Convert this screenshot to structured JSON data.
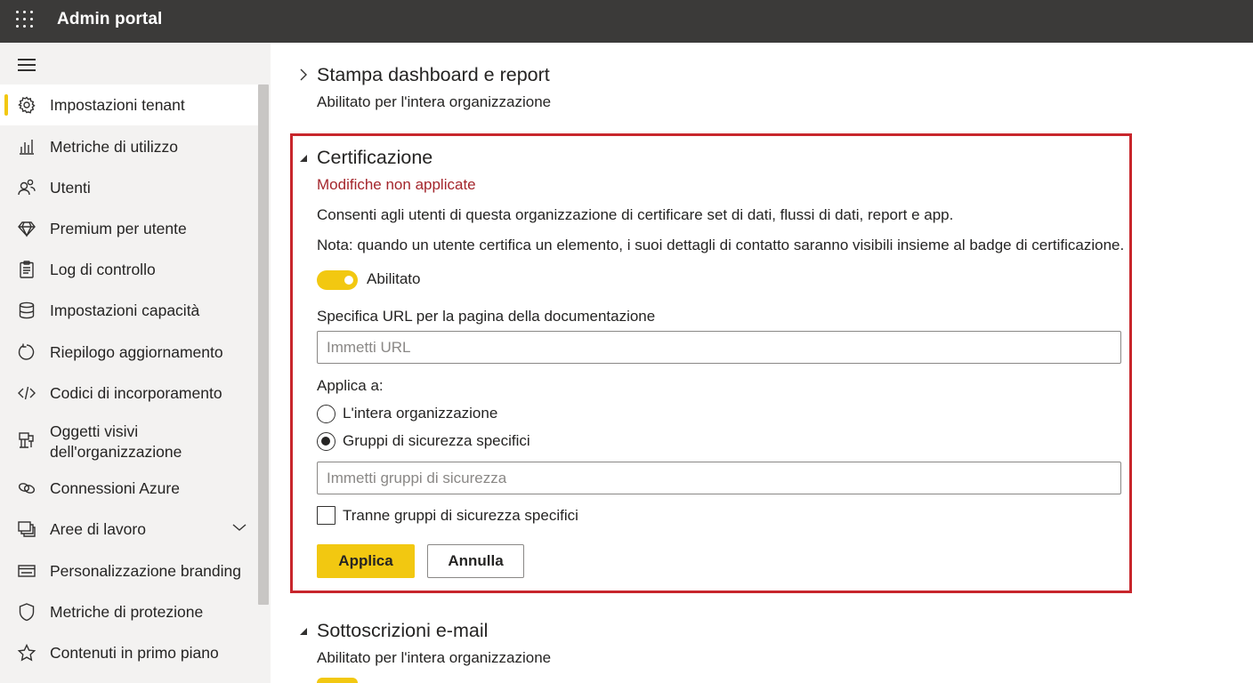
{
  "app": {
    "title": "Admin portal"
  },
  "sidebar": {
    "items": [
      {
        "label": "Impostazioni tenant",
        "icon": "gear-icon",
        "active": true
      },
      {
        "label": "Metriche di utilizzo",
        "icon": "bar-chart-icon"
      },
      {
        "label": "Utenti",
        "icon": "users-icon"
      },
      {
        "label": "Premium per utente",
        "icon": "diamond-icon"
      },
      {
        "label": "Log di controllo",
        "icon": "clipboard-icon"
      },
      {
        "label": "Impostazioni capacità",
        "icon": "database-icon"
      },
      {
        "label": "Riepilogo aggiornamento",
        "icon": "refresh-icon"
      },
      {
        "label": "Codici di incorporamento",
        "icon": "code-icon"
      },
      {
        "label": "Oggetti visivi dell'organizzazione",
        "label_line1": "Oggetti visivi",
        "label_line2": "dell'organizzazione",
        "icon": "visuals-icon"
      },
      {
        "label": "Connessioni Azure",
        "icon": "link-icon"
      },
      {
        "label": "Aree di lavoro",
        "icon": "workspaces-icon",
        "expandable": true
      },
      {
        "label": "Personalizzazione branding",
        "icon": "branding-icon"
      },
      {
        "label": "Metriche di protezione",
        "icon": "shield-icon"
      },
      {
        "label": "Contenuti in primo piano",
        "icon": "star-icon"
      }
    ]
  },
  "main": {
    "section_print": {
      "title": "Stampa dashboard e report",
      "status": "Abilitato per l'intera organizzazione"
    },
    "section_cert": {
      "title": "Certificazione",
      "warning": "Modifiche non applicate",
      "description": "Consenti agli utenti di questa organizzazione di certificare set di dati, flussi di dati, report e app.",
      "note": "Nota: quando un utente certifica un elemento, i suoi dettagli di contatto saranno visibili insieme al badge di certificazione.",
      "toggle_label": "Abilitato",
      "toggle_on": true,
      "url_label": "Specifica URL per la pagina della documentazione",
      "url_value": "",
      "url_placeholder": "Immetti URL",
      "apply_to_label": "Applica a:",
      "radio_all": "L'intera organizzazione",
      "radio_specific": "Gruppi di sicurezza specifici",
      "selected_radio": "specific",
      "groups_value": "",
      "groups_placeholder": "Immetti gruppi di sicurezza",
      "except_label": "Tranne gruppi di sicurezza specifici",
      "except_checked": false,
      "apply_button": "Applica",
      "cancel_button": "Annulla"
    },
    "section_email": {
      "title": "Sottoscrizioni e-mail",
      "status": "Abilitato per l'intera organizzazione"
    }
  },
  "colors": {
    "topbar": "#3b3a39",
    "accent": "#f2c811",
    "highlight_border": "#c8262c",
    "warning_text": "#a4262c",
    "sidebar_bg": "#f3f2f1"
  }
}
